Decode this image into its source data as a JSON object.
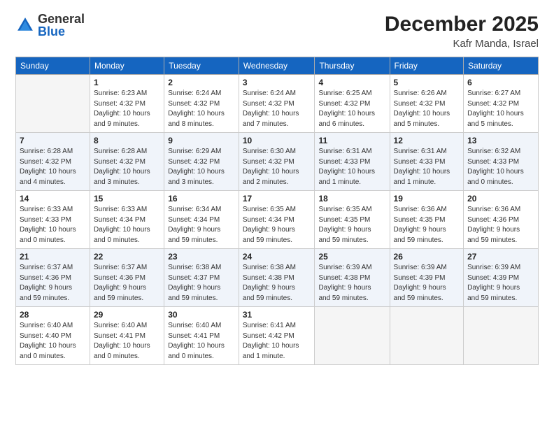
{
  "logo": {
    "general": "General",
    "blue": "Blue"
  },
  "header": {
    "month": "December 2025",
    "location": "Kafr Manda, Israel"
  },
  "days_of_week": [
    "Sunday",
    "Monday",
    "Tuesday",
    "Wednesday",
    "Thursday",
    "Friday",
    "Saturday"
  ],
  "weeks": [
    [
      {
        "num": "",
        "info": "",
        "empty": true
      },
      {
        "num": "1",
        "info": "Sunrise: 6:23 AM\nSunset: 4:32 PM\nDaylight: 10 hours\nand 9 minutes."
      },
      {
        "num": "2",
        "info": "Sunrise: 6:24 AM\nSunset: 4:32 PM\nDaylight: 10 hours\nand 8 minutes."
      },
      {
        "num": "3",
        "info": "Sunrise: 6:24 AM\nSunset: 4:32 PM\nDaylight: 10 hours\nand 7 minutes."
      },
      {
        "num": "4",
        "info": "Sunrise: 6:25 AM\nSunset: 4:32 PM\nDaylight: 10 hours\nand 6 minutes."
      },
      {
        "num": "5",
        "info": "Sunrise: 6:26 AM\nSunset: 4:32 PM\nDaylight: 10 hours\nand 5 minutes."
      },
      {
        "num": "6",
        "info": "Sunrise: 6:27 AM\nSunset: 4:32 PM\nDaylight: 10 hours\nand 5 minutes."
      }
    ],
    [
      {
        "num": "7",
        "info": "Sunrise: 6:28 AM\nSunset: 4:32 PM\nDaylight: 10 hours\nand 4 minutes."
      },
      {
        "num": "8",
        "info": "Sunrise: 6:28 AM\nSunset: 4:32 PM\nDaylight: 10 hours\nand 3 minutes."
      },
      {
        "num": "9",
        "info": "Sunrise: 6:29 AM\nSunset: 4:32 PM\nDaylight: 10 hours\nand 3 minutes."
      },
      {
        "num": "10",
        "info": "Sunrise: 6:30 AM\nSunset: 4:32 PM\nDaylight: 10 hours\nand 2 minutes."
      },
      {
        "num": "11",
        "info": "Sunrise: 6:31 AM\nSunset: 4:33 PM\nDaylight: 10 hours\nand 1 minute."
      },
      {
        "num": "12",
        "info": "Sunrise: 6:31 AM\nSunset: 4:33 PM\nDaylight: 10 hours\nand 1 minute."
      },
      {
        "num": "13",
        "info": "Sunrise: 6:32 AM\nSunset: 4:33 PM\nDaylight: 10 hours\nand 0 minutes."
      }
    ],
    [
      {
        "num": "14",
        "info": "Sunrise: 6:33 AM\nSunset: 4:33 PM\nDaylight: 10 hours\nand 0 minutes."
      },
      {
        "num": "15",
        "info": "Sunrise: 6:33 AM\nSunset: 4:34 PM\nDaylight: 10 hours\nand 0 minutes."
      },
      {
        "num": "16",
        "info": "Sunrise: 6:34 AM\nSunset: 4:34 PM\nDaylight: 9 hours\nand 59 minutes."
      },
      {
        "num": "17",
        "info": "Sunrise: 6:35 AM\nSunset: 4:34 PM\nDaylight: 9 hours\nand 59 minutes."
      },
      {
        "num": "18",
        "info": "Sunrise: 6:35 AM\nSunset: 4:35 PM\nDaylight: 9 hours\nand 59 minutes."
      },
      {
        "num": "19",
        "info": "Sunrise: 6:36 AM\nSunset: 4:35 PM\nDaylight: 9 hours\nand 59 minutes."
      },
      {
        "num": "20",
        "info": "Sunrise: 6:36 AM\nSunset: 4:36 PM\nDaylight: 9 hours\nand 59 minutes."
      }
    ],
    [
      {
        "num": "21",
        "info": "Sunrise: 6:37 AM\nSunset: 4:36 PM\nDaylight: 9 hours\nand 59 minutes."
      },
      {
        "num": "22",
        "info": "Sunrise: 6:37 AM\nSunset: 4:36 PM\nDaylight: 9 hours\nand 59 minutes."
      },
      {
        "num": "23",
        "info": "Sunrise: 6:38 AM\nSunset: 4:37 PM\nDaylight: 9 hours\nand 59 minutes."
      },
      {
        "num": "24",
        "info": "Sunrise: 6:38 AM\nSunset: 4:38 PM\nDaylight: 9 hours\nand 59 minutes."
      },
      {
        "num": "25",
        "info": "Sunrise: 6:39 AM\nSunset: 4:38 PM\nDaylight: 9 hours\nand 59 minutes."
      },
      {
        "num": "26",
        "info": "Sunrise: 6:39 AM\nSunset: 4:39 PM\nDaylight: 9 hours\nand 59 minutes."
      },
      {
        "num": "27",
        "info": "Sunrise: 6:39 AM\nSunset: 4:39 PM\nDaylight: 9 hours\nand 59 minutes."
      }
    ],
    [
      {
        "num": "28",
        "info": "Sunrise: 6:40 AM\nSunset: 4:40 PM\nDaylight: 10 hours\nand 0 minutes."
      },
      {
        "num": "29",
        "info": "Sunrise: 6:40 AM\nSunset: 4:41 PM\nDaylight: 10 hours\nand 0 minutes."
      },
      {
        "num": "30",
        "info": "Sunrise: 6:40 AM\nSunset: 4:41 PM\nDaylight: 10 hours\nand 0 minutes."
      },
      {
        "num": "31",
        "info": "Sunrise: 6:41 AM\nSunset: 4:42 PM\nDaylight: 10 hours\nand 1 minute."
      },
      {
        "num": "",
        "info": "",
        "empty": true
      },
      {
        "num": "",
        "info": "",
        "empty": true
      },
      {
        "num": "",
        "info": "",
        "empty": true
      }
    ]
  ]
}
